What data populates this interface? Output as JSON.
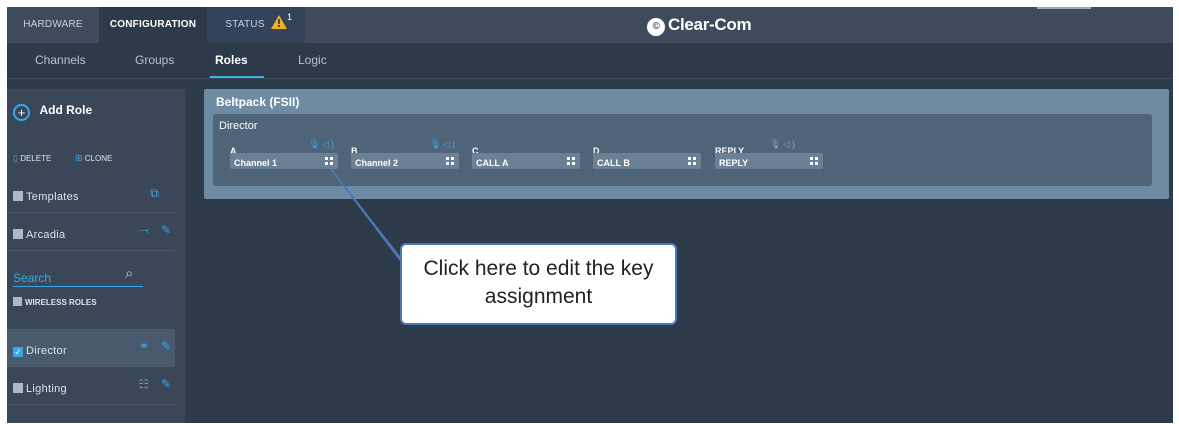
{
  "topbar": {
    "tabs": [
      {
        "label": "HARDWARE"
      },
      {
        "label": "CONFIGURATION"
      },
      {
        "label": "STATUS"
      }
    ],
    "status_count": "1",
    "logo": "Clear-Com",
    "logo_mark": "©"
  },
  "subnav": {
    "tabs": [
      {
        "label": "Channels"
      },
      {
        "label": "Groups"
      },
      {
        "label": "Roles"
      },
      {
        "label": "Logic"
      }
    ]
  },
  "sidebar": {
    "add_role": "Add Role",
    "delete": "DELETE",
    "clone": "CLONE",
    "templates": "Templates",
    "arcadia": "Arcadia",
    "search_placeholder": "Search",
    "wireless_roles": "WIRELESS ROLES",
    "roles": [
      {
        "label": "Director",
        "checked": true
      },
      {
        "label": "Lighting",
        "checked": false
      }
    ]
  },
  "panel": {
    "title": "Beltpack (FSII)",
    "role": "Director",
    "keys": [
      {
        "name": "A",
        "value": "Channel 1",
        "icons": "mic-speaker"
      },
      {
        "name": "B",
        "value": "Channel 2",
        "icons": "mic-speaker"
      },
      {
        "name": "C",
        "value": "CALL A",
        "icons": ""
      },
      {
        "name": "D",
        "value": "CALL B",
        "icons": ""
      },
      {
        "name": "REPLY",
        "value": "REPLY",
        "icons": "mic-speaker-dim"
      }
    ]
  },
  "callout": {
    "text": "Click here to edit the key assignment"
  },
  "colors": {
    "background": "#2d3a4a",
    "accent": "#39a6e6",
    "warning": "#f2b21b"
  }
}
